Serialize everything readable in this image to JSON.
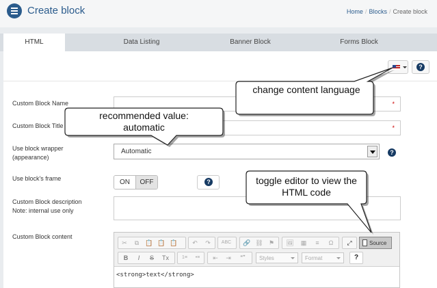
{
  "header": {
    "title": "Create block",
    "breadcrumb": {
      "home": "Home",
      "blocks": "Blocks",
      "current": "Create block"
    }
  },
  "tabs": [
    "HTML",
    "Data Listing",
    "Banner Block",
    "Forms Block"
  ],
  "active_tab": "HTML",
  "form": {
    "name_label": "Custom Block Name",
    "title_label": "Custom Block Title",
    "required_mark": "*",
    "wrapper_label_1": "Use block wrapper",
    "wrapper_label_2": "(appearance)",
    "wrapper_value": "Automatic",
    "frame_label": "Use block's frame",
    "frame_on": "ON",
    "frame_off": "OFF",
    "desc_label_1": "Custom Block description",
    "desc_label_2": "Note: internal use only",
    "content_label": "Custom Block content",
    "help_symbol": "?"
  },
  "editor": {
    "styles_placeholder": "Styles",
    "format_placeholder": "Format",
    "source_label": "Source",
    "content": "<strong>text</strong>",
    "toolbar_row1": [
      "✂",
      "⧉",
      "📋",
      "📋",
      "📋",
      "↶",
      "↷",
      "ABC",
      "🔗",
      "⛓",
      "⚑",
      "🖼",
      "▦",
      "≡",
      "Ω",
      "⤢"
    ],
    "toolbar_row2": [
      "B",
      "I",
      "S",
      "Tx",
      "1≡",
      "•≡",
      "⇤",
      "⇥",
      "❝❞",
      "?"
    ]
  },
  "callouts": {
    "language": "change content language",
    "recommended_1": "recommended value:",
    "recommended_2": "automatic",
    "toggle_1": "toggle editor to view the",
    "toggle_2": "HTML code"
  },
  "colors": {
    "accent": "#2a5b8c",
    "help": "#163a63",
    "required": "#cc0000"
  }
}
